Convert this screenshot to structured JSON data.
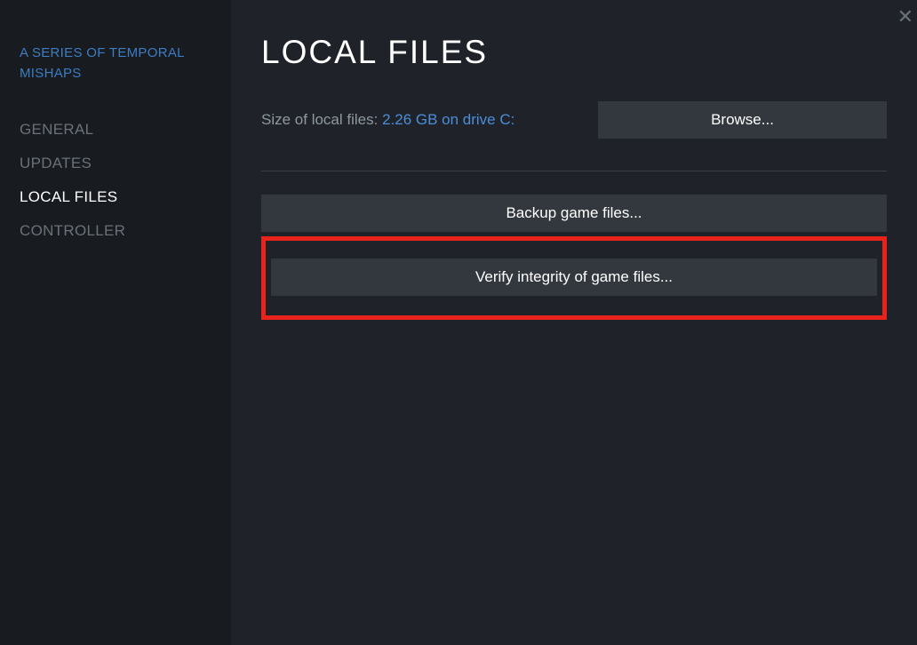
{
  "sidebar": {
    "gameTitle": "A SERIES OF TEMPORAL MISHAPS",
    "items": [
      {
        "label": "GENERAL",
        "active": false
      },
      {
        "label": "UPDATES",
        "active": false
      },
      {
        "label": "LOCAL FILES",
        "active": true
      },
      {
        "label": "CONTROLLER",
        "active": false
      }
    ]
  },
  "main": {
    "title": "LOCAL FILES",
    "sizeLabel": "Size of local files: ",
    "sizeValue": "2.26 GB on drive C:",
    "browseLabel": "Browse...",
    "backupLabel": "Backup game files...",
    "verifyLabel": "Verify integrity of game files..."
  },
  "close": "✕"
}
